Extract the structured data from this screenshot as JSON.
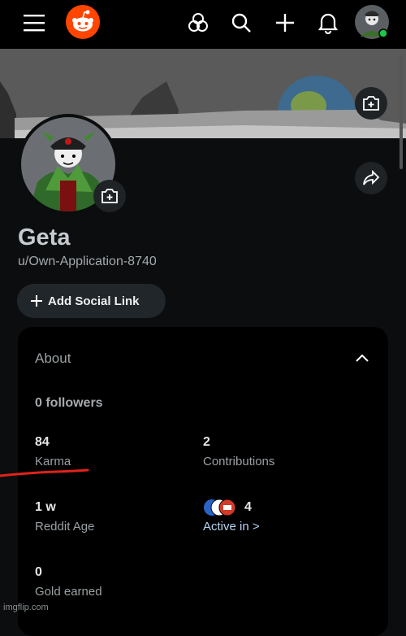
{
  "header": {
    "icons": [
      "menu-icon",
      "reddit-logo",
      "explore-icon",
      "search-icon",
      "create-icon",
      "notifications-icon",
      "user-avatar"
    ]
  },
  "profile": {
    "display_name": "Geta",
    "username": "u/Own-Application-8740",
    "social_button_label": "Add Social Link"
  },
  "about": {
    "title": "About",
    "followers": "0 followers",
    "stats": {
      "karma": {
        "value": "84",
        "label": "Karma"
      },
      "contributions": {
        "value": "2",
        "label": "Contributions"
      },
      "reddit_age": {
        "value": "1 w",
        "label": "Reddit Age"
      },
      "active_in": {
        "value": "4",
        "label": "Active in >"
      },
      "gold": {
        "value": "0",
        "label": "Gold earned"
      }
    }
  },
  "watermark": "imgflip.com",
  "colors": {
    "reddit_orange": "#ff4500",
    "underline_red": "#e0221b"
  }
}
